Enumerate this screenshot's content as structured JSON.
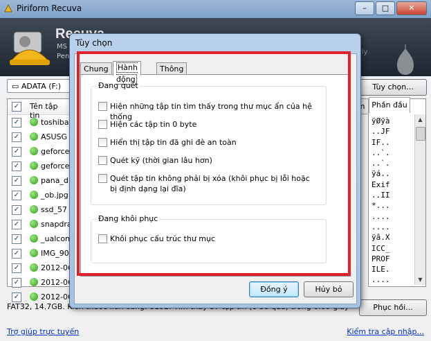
{
  "app": {
    "title": "Piriform Recuva",
    "brand": "Recuva",
    "header_line1": "MS",
    "header_line2": "Pen",
    "header_suffix": "ily",
    "drive": "ADATA (F:)",
    "options_button": "Tùy chọn...",
    "column_filename": "Tên tập tin",
    "files": [
      {
        "name": "toshiba",
        "checked": true
      },
      {
        "name": "ASUSG",
        "checked": true
      },
      {
        "name": "geforce",
        "checked": true
      },
      {
        "name": "geforce",
        "checked": true
      },
      {
        "name": "pana_d",
        "checked": true
      },
      {
        "name": "_ob.jpg",
        "checked": true
      },
      {
        "name": "ssd_57",
        "checked": true
      },
      {
        "name": "snapdra",
        "checked": true
      },
      {
        "name": "_ualcon",
        "checked": true
      },
      {
        "name": "IMG_90",
        "checked": true
      },
      {
        "name": "2012-06",
        "checked": true
      },
      {
        "name": "2012-06",
        "checked": true
      },
      {
        "name": "2012-06",
        "checked": true
      }
    ],
    "hex_tab_partial": "n",
    "hex_tab": "Phần đầu",
    "hex_lines": [
      "ÿØÿà",
      "..JF",
      "IF..",
      "..`.",
      "..`.",
      "ÿá..",
      "Exif",
      "..II",
      "*...",
      "....",
      "....",
      "ÿâ.X",
      "ICC_",
      "PROF",
      "ILE.",
      "...."
    ],
    "status": "FAT32, 14.7GB. Kích thước liên cung: 8192. Tìm thấy 37 tập tin (0 bỏ qua) trong 0.09 giây",
    "recover_button": "Phục hồi...",
    "help_link": "Trợ giúp trực tuyến",
    "update_link": "Kiểm tra cập nhập..."
  },
  "dialog": {
    "title": "Tùy chọn",
    "tabs": [
      "Chung",
      "Hành động",
      "Thông tin"
    ],
    "active_tab": "Hành động",
    "scan_group": "Đang quét",
    "scan_options": [
      "Hiện những tập tin tìm thấy trong thư mục ẩn của hệ thống",
      "Hiện các tập tin 0 byte",
      "Hiển thị tập tin đã ghi đè an toàn",
      "Quét kỹ (thời gian lâu hơn)",
      "Quét tập tin không phải bị xóa (khôi phục bị lỗi hoặc bị định dạng lại đĩa)"
    ],
    "restore_group": "Đang khôi phục",
    "restore_options": [
      "Khôi phục cấu trúc thư mục"
    ],
    "ok_button": "Đồng ý",
    "cancel_button": "Hủy bỏ"
  },
  "colors": {
    "highlight": "#e0202a",
    "link": "#0033cc",
    "title_bar": "#9db9d8"
  }
}
